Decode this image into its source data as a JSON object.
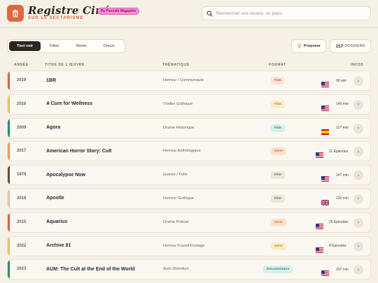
{
  "brand": {
    "title": "Registre Ciné",
    "badge": "By Pascale Magazine",
    "subtitle": "SUR LE SECTARISME"
  },
  "search": {
    "placeholder": "Rechercher une œuvre, un pays..."
  },
  "tabs": [
    {
      "label": "Tout voir",
      "active": true
    },
    {
      "label": "Films",
      "active": false
    },
    {
      "label": "Séries",
      "active": false
    },
    {
      "label": "Docus",
      "active": false
    }
  ],
  "propose_label": "Proposer",
  "count": {
    "value": "157",
    "label": "DOSSIERS"
  },
  "columns": {
    "year": "ANNÉE",
    "title": "TITRE DE L'ŒUVRE",
    "theme": "THÉMATIQUE",
    "format": "FORMAT",
    "infos": "INFOS"
  },
  "rows": [
    {
      "year": "2019",
      "title": "1BR",
      "theme": "Horreur / Communauté",
      "format": "Film",
      "format_style": "fmt-film",
      "country": "US",
      "duration": "90 min",
      "stripe": "#d9603a"
    },
    {
      "year": "2016",
      "title": "A Cure for Wellness",
      "theme": "Thriller Gothique",
      "format": "Film",
      "format_style": "fmt-film-y",
      "country": "US",
      "duration": "146 min",
      "stripe": "#e8c26a"
    },
    {
      "year": "2009",
      "title": "Agora",
      "theme": "Drame Historique",
      "format": "Film",
      "format_style": "fmt-film-t",
      "country": "ES",
      "duration": "127 min",
      "stripe": "#2a8a78"
    },
    {
      "year": "2017",
      "title": "American Horror Story: Cult",
      "theme": "Horreur Anthologique",
      "format": "Série",
      "format_style": "fmt-serie",
      "country": "US",
      "duration": "11 Épisodes",
      "stripe": "#e89a60"
    },
    {
      "year": "1979",
      "title": "Apocalypse Now",
      "theme": "Guerre / Folie",
      "format": "Film",
      "format_style": "fmt-film-g",
      "country": "US",
      "duration": "147 min",
      "stripe": "#6a4a36"
    },
    {
      "year": "2018",
      "title": "Apostle",
      "theme": "Horreur Gothique",
      "format": "Film",
      "format_style": "fmt-film-g",
      "country": "GB",
      "duration": "130 min",
      "stripe": "#d8c8b8"
    },
    {
      "year": "2015",
      "title": "Aquarius",
      "theme": "Drame Policier",
      "format": "Série",
      "format_style": "fmt-serie",
      "country": "US",
      "duration": "26 Épisodes",
      "stripe": "#d9603a"
    },
    {
      "year": "2022",
      "title": "Archive 81",
      "theme": "Horreur Found Footage",
      "format": "Série",
      "format_style": "fmt-serie-y",
      "country": "US",
      "duration": "8 Épisodes",
      "stripe": "#e8c26a"
    },
    {
      "year": "2023",
      "title": "AUM: The Cult at the End of the World",
      "theme": "Aum Shinrikyo",
      "format": "Documentaire",
      "format_style": "fmt-doc",
      "country": "US",
      "duration": "107 min",
      "stripe": "#2a8a78"
    }
  ]
}
